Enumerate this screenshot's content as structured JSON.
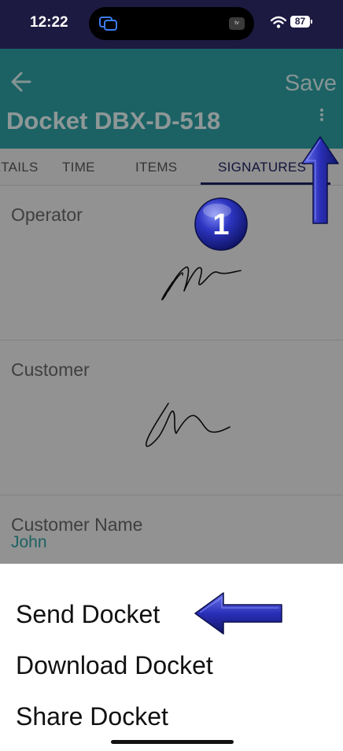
{
  "status_bar": {
    "time": "12:22",
    "battery": "87"
  },
  "app_bar": {
    "back_icon": "arrow-left-icon",
    "save_label": "Save",
    "title": "Docket DBX-D-518",
    "more_icon": "more-vertical-icon"
  },
  "tabs": [
    {
      "label": "DETAILS"
    },
    {
      "label": "TIME"
    },
    {
      "label": "ITEMS"
    },
    {
      "label": "SIGNATURES"
    }
  ],
  "sections": {
    "operator_label": "Operator",
    "customer_label": "Customer",
    "customer_name_label": "Customer Name",
    "customer_name_value": "John"
  },
  "menu": {
    "items": [
      {
        "label": "Send Docket"
      },
      {
        "label": "Download Docket"
      },
      {
        "label": "Share Docket"
      }
    ]
  },
  "annotations": {
    "step_number": "1"
  },
  "colors": {
    "status_bar": "#1d1a41",
    "app_bar": "#2e9ea3",
    "accent": "#2e9ea3",
    "tab_active": "#1d2160",
    "annotation_arrow": "#2a2fb8"
  }
}
